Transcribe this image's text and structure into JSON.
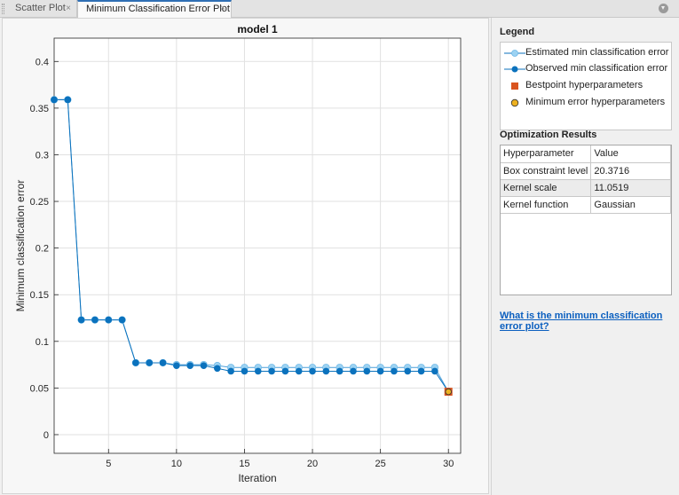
{
  "tabs": [
    {
      "label": "Scatter Plot",
      "active": false
    },
    {
      "label": "Minimum Classification Error Plot",
      "active": true
    }
  ],
  "tab_close_glyph": "×",
  "colors": {
    "accent": "#2f6fb4",
    "estimated": "#9cd2f2",
    "observed": "#0b72bd",
    "bestpoint": "#d9541f",
    "min_error": "#edb120",
    "link": "#0b5fbf"
  },
  "legend": {
    "title": "Legend",
    "items": [
      {
        "label": "Estimated min classification error",
        "icon": "light-blue-circle-line-icon"
      },
      {
        "label": "Observed min classification error",
        "icon": "dark-blue-circle-line-icon"
      },
      {
        "label": "Bestpoint hyperparameters",
        "icon": "red-square-icon"
      },
      {
        "label": "Minimum error hyperparameters",
        "icon": "yellow-circle-icon"
      }
    ]
  },
  "results": {
    "title": "Optimization Results",
    "columns": [
      "Hyperparameter",
      "Value"
    ],
    "rows": [
      [
        "Box constraint level",
        "20.3716"
      ],
      [
        "Kernel scale",
        "11.0519"
      ],
      [
        "Kernel function",
        "Gaussian"
      ]
    ]
  },
  "help_link": "What is the minimum classification error plot?",
  "chart_data": {
    "type": "line",
    "title": "model 1",
    "xlabel": "Iteration",
    "ylabel": "Minimum classification error",
    "xlim": [
      1,
      30.9
    ],
    "ylim": [
      -0.02,
      0.425
    ],
    "xticks": [
      5,
      10,
      15,
      20,
      25,
      30
    ],
    "yticks": [
      0,
      0.05,
      0.1,
      0.15,
      0.2,
      0.25,
      0.3,
      0.35,
      0.4
    ],
    "grid": true,
    "x": [
      1,
      2,
      3,
      4,
      5,
      6,
      7,
      8,
      9,
      10,
      11,
      12,
      13,
      14,
      15,
      16,
      17,
      18,
      19,
      20,
      21,
      22,
      23,
      24,
      25,
      26,
      27,
      28,
      29,
      30
    ],
    "series": [
      {
        "name": "Estimated min classification error",
        "values": [
          0.359,
          0.359,
          0.123,
          0.123,
          0.123,
          0.123,
          0.077,
          0.077,
          0.077,
          0.075,
          0.075,
          0.075,
          0.074,
          0.072,
          0.072,
          0.072,
          0.072,
          0.072,
          0.072,
          0.072,
          0.072,
          0.072,
          0.072,
          0.072,
          0.072,
          0.072,
          0.072,
          0.072,
          0.072,
          0.046
        ]
      },
      {
        "name": "Observed min classification error",
        "values": [
          0.359,
          0.359,
          0.123,
          0.123,
          0.123,
          0.123,
          0.077,
          0.077,
          0.077,
          0.074,
          0.074,
          0.074,
          0.071,
          0.068,
          0.068,
          0.068,
          0.068,
          0.068,
          0.068,
          0.068,
          0.068,
          0.068,
          0.068,
          0.068,
          0.068,
          0.068,
          0.068,
          0.068,
          0.068,
          0.046
        ]
      }
    ],
    "bestpoint": {
      "x": 30,
      "y": 0.046
    },
    "min_error": {
      "x": 30,
      "y": 0.046
    }
  }
}
